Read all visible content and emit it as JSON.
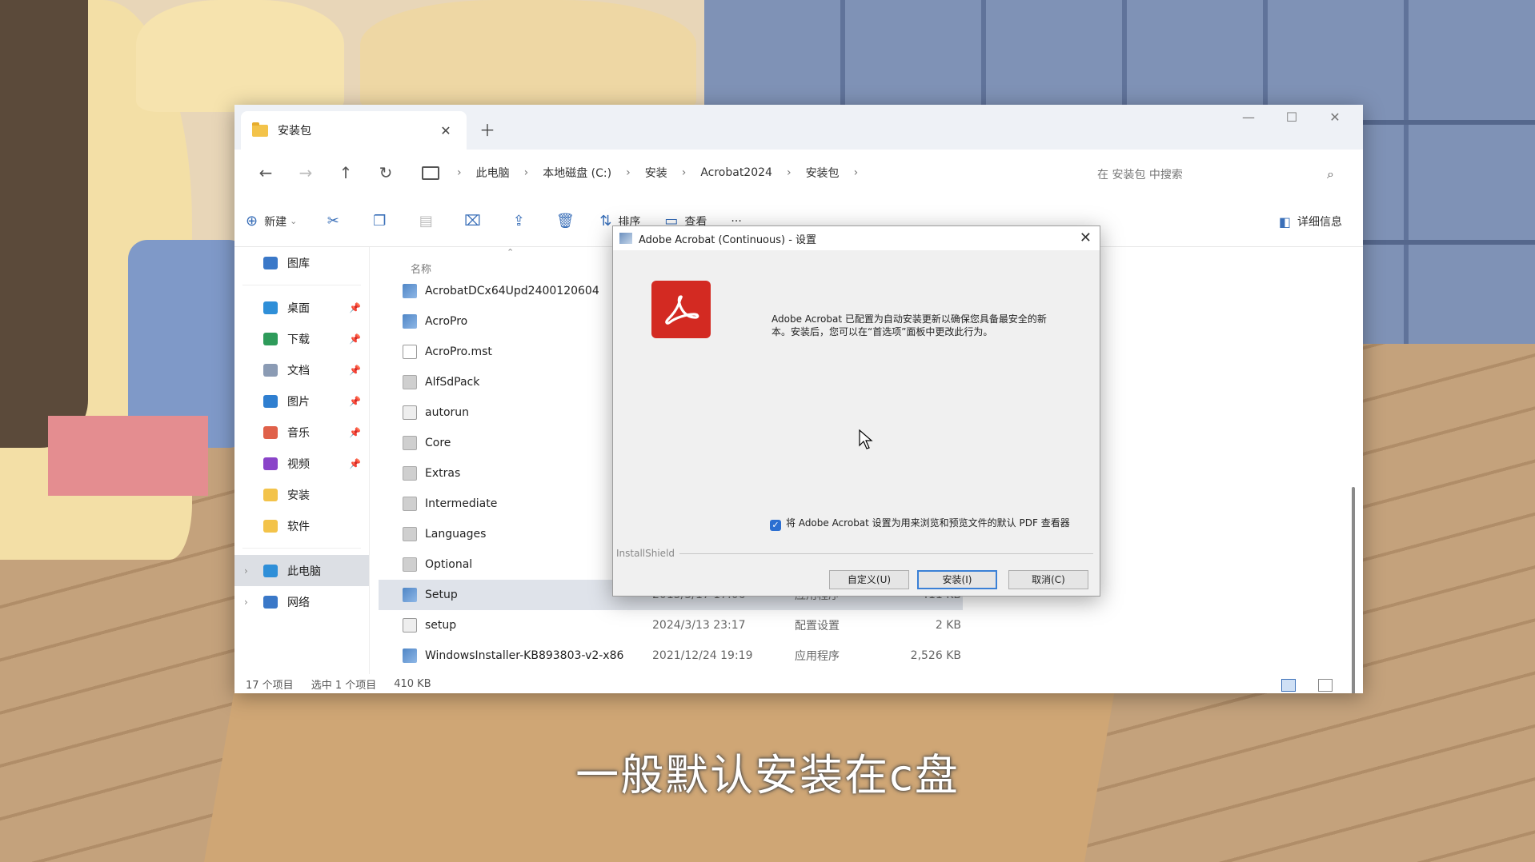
{
  "subtitle": "一般默认安装在c盘",
  "explorer": {
    "tab_title": "安装包",
    "breadcrumb": [
      "此电脑",
      "本地磁盘 (C:)",
      "安装",
      "Acrobat2024",
      "安装包"
    ],
    "search_placeholder": "在 安装包 中搜索",
    "toolbar": {
      "new_label": "新建",
      "sort_label": "排序",
      "view_label": "查看",
      "more_label": "···",
      "details_label": "详细信息"
    },
    "sidebar": [
      {
        "label": "图库",
        "pinned": false,
        "color": "#3a78c8"
      },
      {
        "label": "桌面",
        "pinned": true,
        "color": "#2f8fd8"
      },
      {
        "label": "下载",
        "pinned": true,
        "color": "#2e9b5a"
      },
      {
        "label": "文档",
        "pinned": true,
        "color": "#8b9bb4"
      },
      {
        "label": "图片",
        "pinned": true,
        "color": "#2f7fd0"
      },
      {
        "label": "音乐",
        "pinned": true,
        "color": "#e0614a"
      },
      {
        "label": "视频",
        "pinned": true,
        "color": "#8a44c9"
      },
      {
        "label": "安装",
        "pinned": false,
        "color": "#f3c34a"
      },
      {
        "label": "软件",
        "pinned": false,
        "color": "#f3c34a"
      },
      {
        "label": "此电脑",
        "pinned": false,
        "color": "#2f8fd8"
      },
      {
        "label": "网络",
        "pinned": false,
        "color": "#3a78c8"
      }
    ],
    "column_name": "名称",
    "files": [
      {
        "name": "AcrobatDCx64Upd2400120604",
        "date": "",
        "type": "",
        "size": "",
        "icon": "app"
      },
      {
        "name": "AcroPro",
        "date": "",
        "type": "",
        "size": "",
        "icon": "app"
      },
      {
        "name": "AcroPro.mst",
        "date": "",
        "type": "",
        "size": "",
        "icon": "doc"
      },
      {
        "name": "AlfSdPack",
        "date": "",
        "type": "",
        "size": "",
        "icon": "fold"
      },
      {
        "name": "autorun",
        "date": "",
        "type": "",
        "size": "",
        "icon": "cfg"
      },
      {
        "name": "Core",
        "date": "",
        "type": "",
        "size": "",
        "icon": "fold"
      },
      {
        "name": "Extras",
        "date": "",
        "type": "",
        "size": "",
        "icon": "fold"
      },
      {
        "name": "Intermediate",
        "date": "",
        "type": "",
        "size": "",
        "icon": "fold"
      },
      {
        "name": "Languages",
        "date": "",
        "type": "",
        "size": "",
        "icon": "fold"
      },
      {
        "name": "Optional",
        "date": "",
        "type": "",
        "size": "",
        "icon": "fold"
      },
      {
        "name": "Setup",
        "date": "2015/3/17 17:06",
        "type": "应用程序",
        "size": "411 KB",
        "icon": "app",
        "selected": true
      },
      {
        "name": "setup",
        "date": "2024/3/13 23:17",
        "type": "配置设置",
        "size": "2 KB",
        "icon": "cfg"
      },
      {
        "name": "WindowsInstaller-KB893803-v2-x86",
        "date": "2021/12/24 19:19",
        "type": "应用程序",
        "size": "2,526 KB",
        "icon": "app"
      }
    ],
    "status": {
      "count": "17 个项目",
      "selected": "选中 1 个项目",
      "size": "410 KB"
    }
  },
  "dialog": {
    "title": "Adobe Acrobat (Continuous) - 设置",
    "message": "Adobe Acrobat 已配置为自动安装更新以确保您具备最安全的新本。安装后，您可以在“首选项”面板中更改此行为。",
    "checkbox_label": "将 Adobe Acrobat 设置为用来浏览和预览文件的默认 PDF 查看器",
    "checkbox_checked": true,
    "installshield": "InstallShield",
    "buttons": {
      "customize": "自定义(U)",
      "install": "安装(I)",
      "cancel": "取消(C)"
    },
    "logo_color": "#d32a22"
  }
}
